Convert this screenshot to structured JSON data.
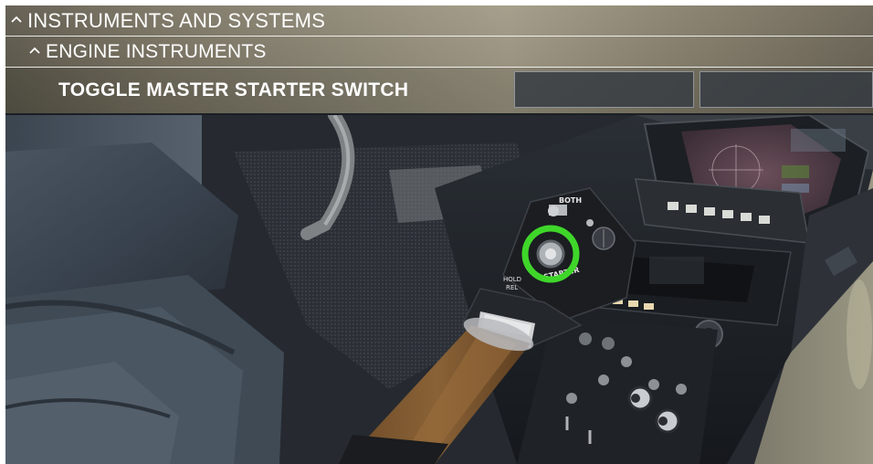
{
  "bindings_panel": {
    "category": {
      "label": "INSTRUMENTS AND SYSTEMS",
      "chevron_icon": "chevron-up-icon"
    },
    "subcategory": {
      "label": "ENGINE INSTRUMENTS",
      "chevron_icon": "chevron-up-icon"
    },
    "binding": {
      "label": "TOGGLE MASTER STARTER SWITCH",
      "primary_input": "",
      "secondary_input": ""
    }
  },
  "scene": {
    "highlight_color": "#3fd62a",
    "switch_labels": {
      "both": "BOTH",
      "starter": "STARTER",
      "hold_rel": "HOLD\nREL"
    }
  }
}
